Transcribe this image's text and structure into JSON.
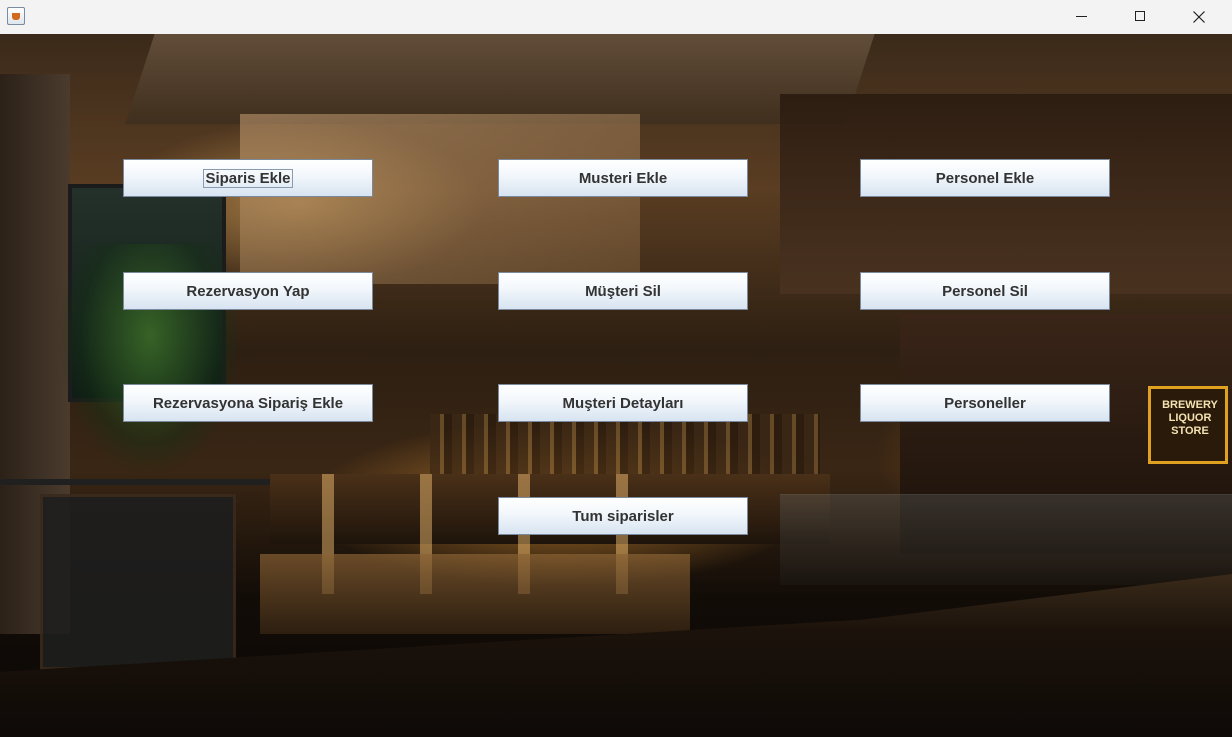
{
  "window": {
    "icon": "java-cup-icon",
    "controls": [
      "minimize-icon",
      "maximize-icon",
      "close-icon"
    ]
  },
  "background": {
    "sign_text": "BREWERY LIQUOR STORE"
  },
  "buttons": {
    "siparis_ekle": "Siparis Ekle",
    "musteri_ekle": "Musteri Ekle",
    "personel_ekle": "Personel Ekle",
    "rezervasyon_yap": "Rezervasyon Yap",
    "musteri_sil": "Müşteri Sil",
    "personel_sil": "Personel Sil",
    "rezervasyona_siparis_ekle": "Rezervasyona Sipariş Ekle",
    "musteri_detaylari": "Muşteri Detayları",
    "personeller": "Personeller",
    "tum_siparisler": "Tum siparisler"
  }
}
